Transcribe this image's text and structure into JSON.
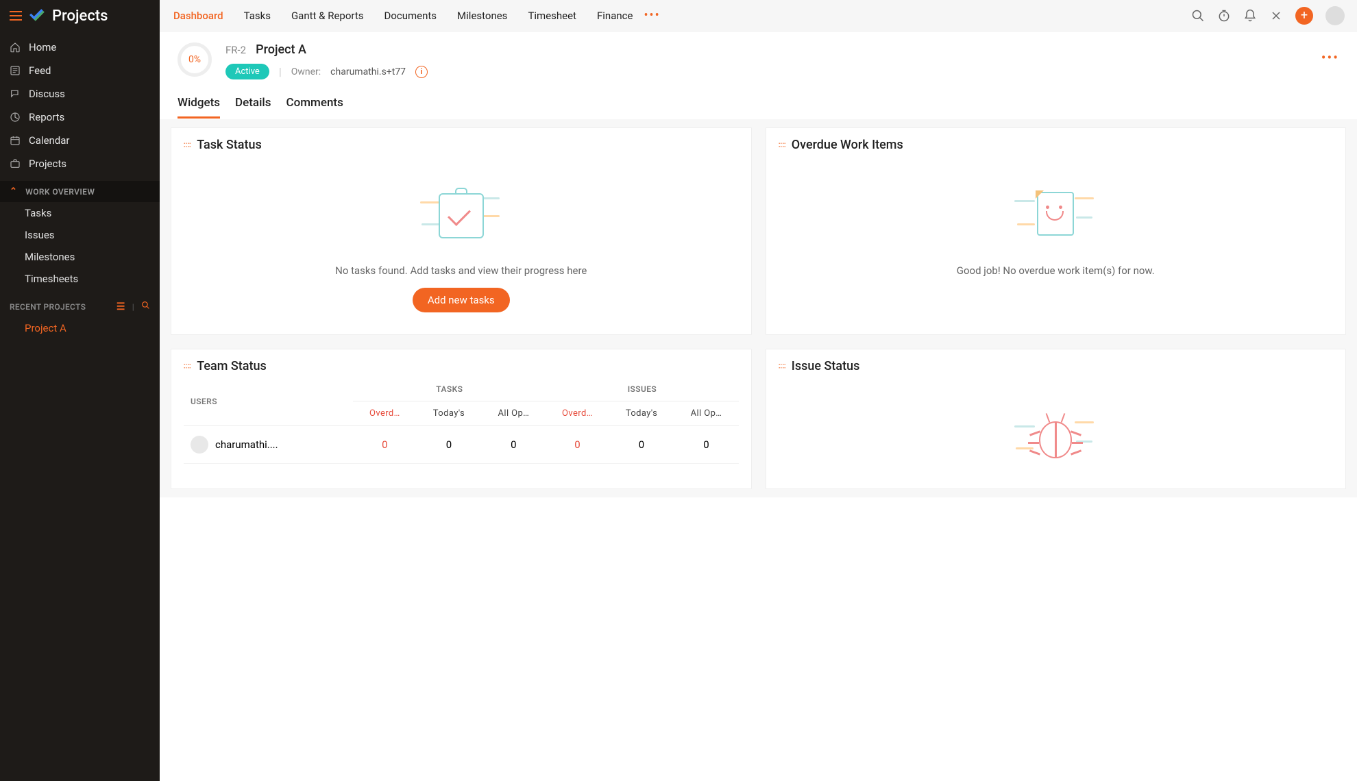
{
  "app": {
    "title": "Projects"
  },
  "sidebar": {
    "nav": [
      {
        "label": "Home",
        "icon": "home"
      },
      {
        "label": "Feed",
        "icon": "feed"
      },
      {
        "label": "Discuss",
        "icon": "discuss"
      },
      {
        "label": "Reports",
        "icon": "reports"
      },
      {
        "label": "Calendar",
        "icon": "calendar"
      },
      {
        "label": "Projects",
        "icon": "projects"
      }
    ],
    "work_overview_label": "WORK OVERVIEW",
    "work_items": [
      {
        "label": "Tasks"
      },
      {
        "label": "Issues"
      },
      {
        "label": "Milestones"
      },
      {
        "label": "Timesheets"
      }
    ],
    "recent_label": "RECENT PROJECTS",
    "recent_items": [
      {
        "label": "Project A"
      }
    ]
  },
  "top_tabs": [
    {
      "label": "Dashboard",
      "active": true
    },
    {
      "label": "Tasks"
    },
    {
      "label": "Gantt & Reports"
    },
    {
      "label": "Documents"
    },
    {
      "label": "Milestones"
    },
    {
      "label": "Timesheet"
    },
    {
      "label": "Finance"
    }
  ],
  "project": {
    "percent": "0%",
    "code": "FR-2",
    "name": "Project A",
    "status": "Active",
    "owner_label": "Owner:",
    "owner_name": "charumathi.s+t77"
  },
  "sub_tabs": [
    {
      "label": "Widgets",
      "active": true
    },
    {
      "label": "Details"
    },
    {
      "label": "Comments"
    }
  ],
  "widgets": {
    "task_status": {
      "title": "Task Status",
      "empty_msg": "No tasks found. Add tasks and view their progress here",
      "button": "Add new tasks"
    },
    "overdue": {
      "title": "Overdue Work Items",
      "empty_msg": "Good job! No overdue work item(s) for now."
    },
    "team_status": {
      "title": "Team Status",
      "headers": {
        "users": "USERS",
        "tasks": "TASKS",
        "issues": "ISSUES"
      },
      "sub_headers": {
        "overdue": "Overd…",
        "todays": "Today's",
        "allopen": "All Op…"
      },
      "rows": [
        {
          "user": "charumathi....",
          "t_over": "0",
          "t_today": "0",
          "t_open": "0",
          "i_over": "0",
          "i_today": "0",
          "i_open": "0"
        }
      ]
    },
    "issue_status": {
      "title": "Issue Status"
    }
  }
}
